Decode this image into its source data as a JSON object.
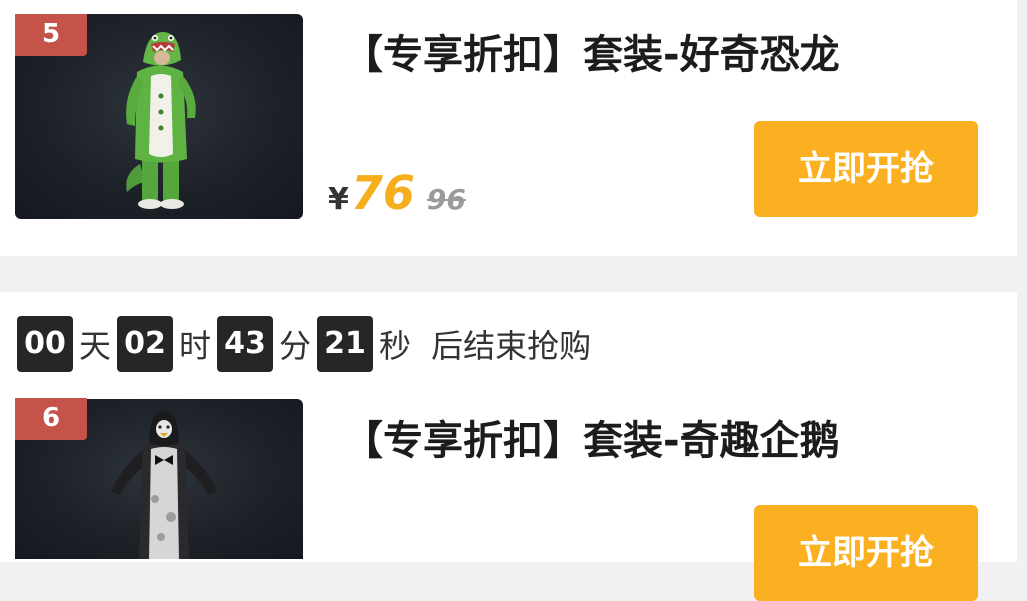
{
  "items": [
    {
      "rank": "5",
      "image_label": "绿色恐龙套装",
      "title": "【专享折扣】套装-好奇恐龙",
      "currency": "¥",
      "price_now": "76",
      "price_old": "96",
      "button_label": "立即开抢"
    },
    {
      "rank": "6",
      "image_label": "企鹅套装",
      "title": "【专享折扣】套装-奇趣企鹅",
      "button_label": "立即开抢"
    }
  ],
  "countdown": {
    "days": "00",
    "days_unit": "天",
    "hours": "02",
    "hours_unit": "时",
    "minutes": "43",
    "minutes_unit": "分",
    "seconds": "21",
    "seconds_unit": "秒",
    "suffix": "后结束抢购"
  },
  "colors": {
    "accent": "#fbb022",
    "price": "#f5ae1c",
    "badge": "#c6534a",
    "countdown_box": "#262626"
  }
}
